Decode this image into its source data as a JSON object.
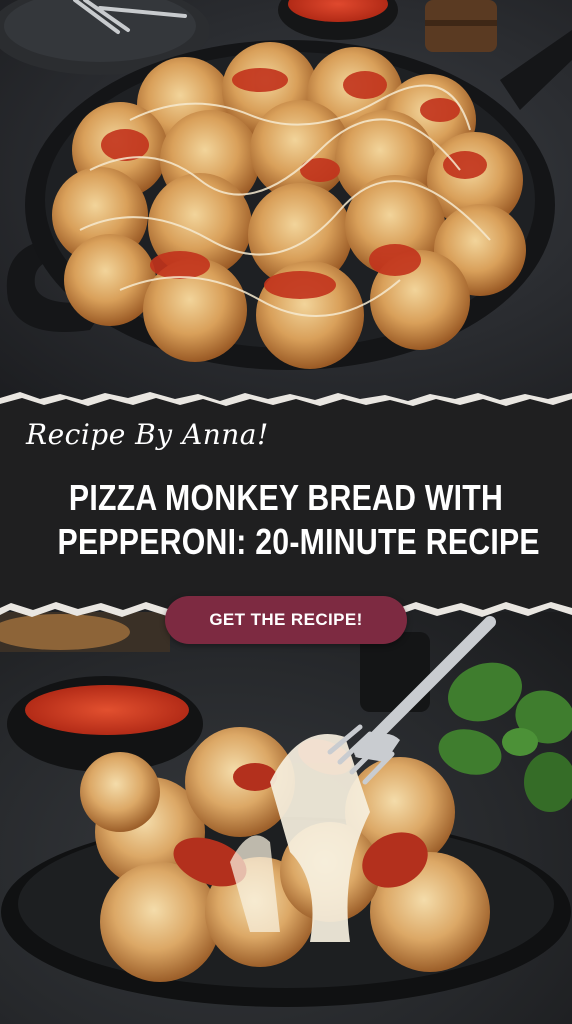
{
  "pin": {
    "byline": "Recipe By Anna!",
    "headline_line1": "PIZZA MONKEY BREAD WITH",
    "headline_line2": "PEPPERONI: 20-MINUTE RECIPE",
    "cta_label": "GET THE RECIPE!"
  },
  "colors": {
    "banner": "#1f1f20",
    "cta": "#7d2a41",
    "text": "#ffffff"
  },
  "icons": {
    "top_photo": "skillet-monkey-bread-photo",
    "bottom_photo": "cheese-pull-monkey-bread-photo"
  }
}
